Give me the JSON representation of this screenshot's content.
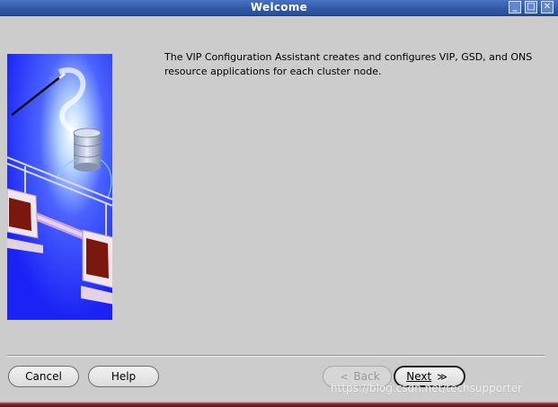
{
  "window": {
    "title": "Welcome"
  },
  "window_controls": {
    "minimize": "_",
    "maximize": "□",
    "close": "✕"
  },
  "content": {
    "intro_text": "The VIP Configuration Assistant creates and configures VIP, GSD, and ONS resource applications for each cluster node."
  },
  "buttons": {
    "cancel": "Cancel",
    "help": "Help",
    "back": "Back",
    "next": "Next",
    "back_chevron": "<",
    "next_chevron": "≫"
  },
  "watermark": "https://blog.csdn.net/techsupporter",
  "colors": {
    "title_bar": "#2f58a8",
    "background": "#cccccc",
    "image_blue": "#1f2bff"
  }
}
